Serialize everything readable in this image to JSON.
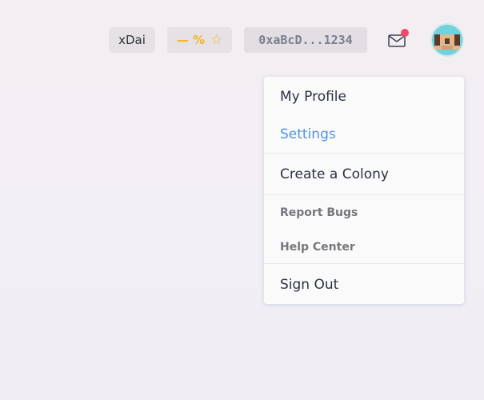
{
  "header": {
    "network": "xDai",
    "reputation": {
      "value": "— %",
      "icon": "star-outline-icon",
      "color": "#f5b21f"
    },
    "wallet_address": "0xaBcD...1234",
    "inbox": {
      "icon": "envelope-icon",
      "has_unread": true,
      "badge_color": "#f5476a"
    },
    "avatar": {
      "icon": "pixel-avatar-icon",
      "colors": [
        "#6fd3dd",
        "#e2b98f",
        "#5a3a28"
      ]
    }
  },
  "menu": {
    "items": [
      {
        "label": "My Profile"
      },
      {
        "label": "Settings",
        "active": true,
        "color": "#4f93e9"
      },
      {
        "label": "Create a Colony"
      },
      {
        "label": "Report Bugs"
      },
      {
        "label": "Help Center"
      },
      {
        "label": "Sign Out"
      }
    ]
  }
}
